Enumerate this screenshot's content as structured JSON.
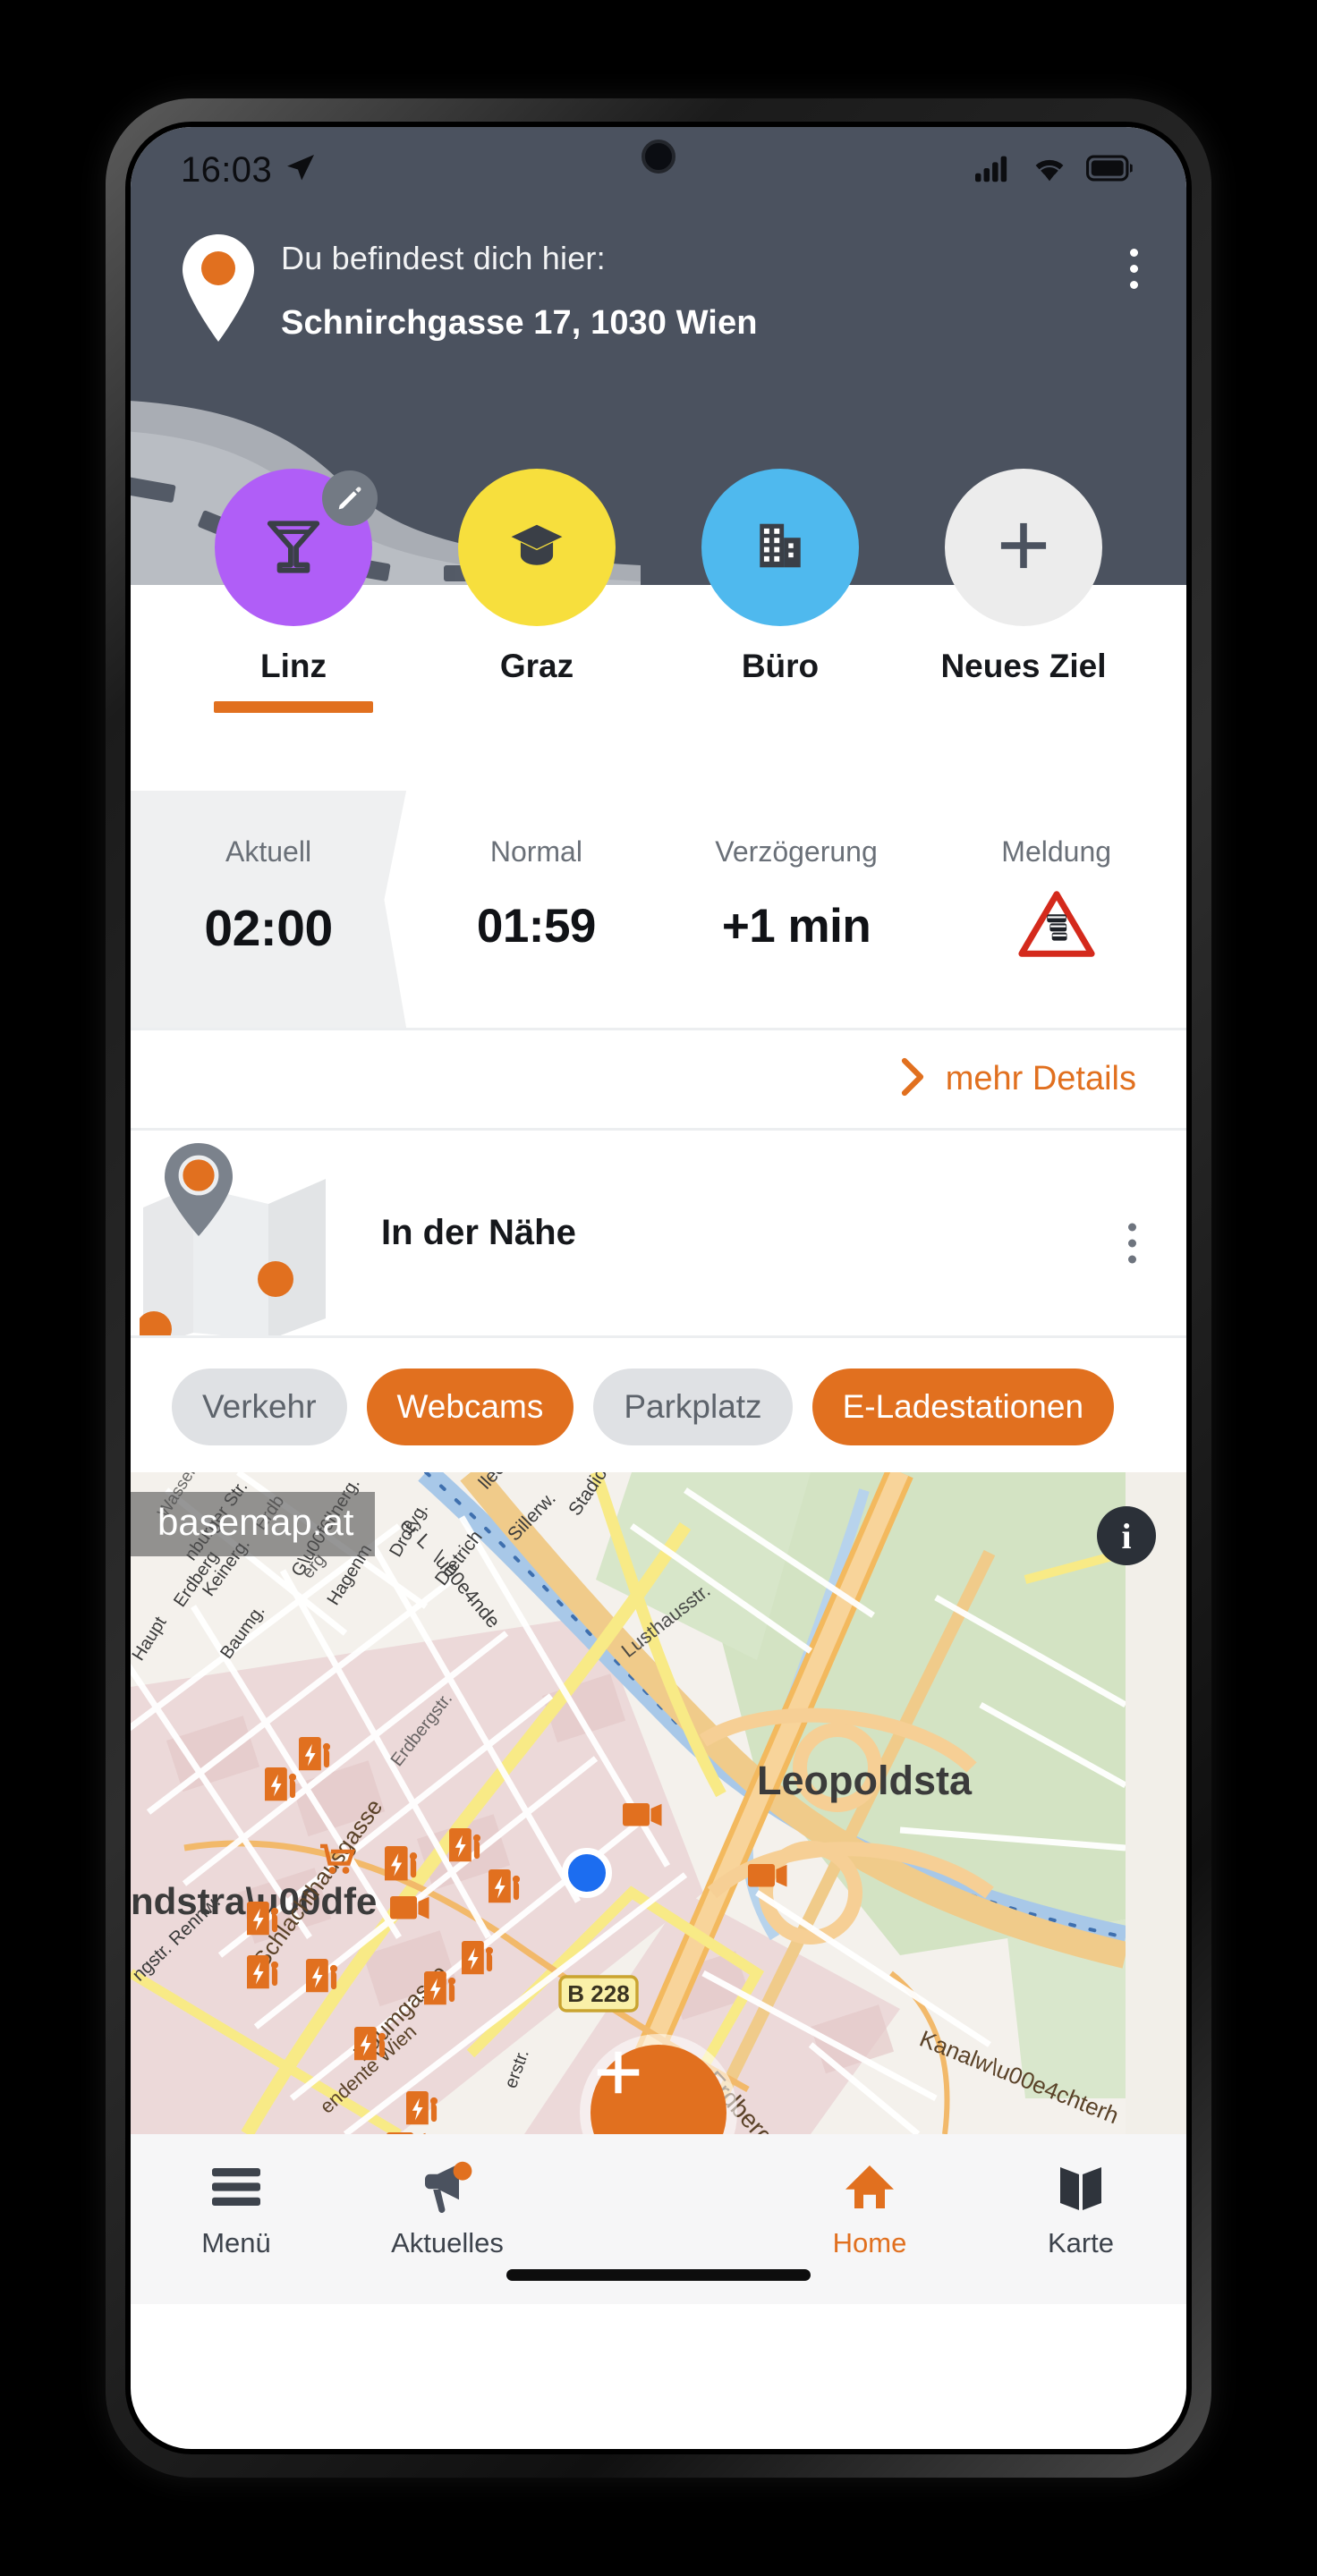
{
  "status_bar": {
    "time": "16:03",
    "location_arrow_icon": "navigation-arrow-icon",
    "signal_icon": "cellular-signal-icon",
    "wifi_icon": "wifi-icon",
    "battery_icon": "battery-full-icon"
  },
  "header": {
    "background_color": "#4b525f",
    "pin_icon": "map-pin-icon",
    "label": "Du befindest dich hier:",
    "address": "Schnirchgasse 17, 1030 Wien",
    "overflow_icon": "kebab-menu-icon"
  },
  "destinations": {
    "items": [
      {
        "label": "Linz",
        "icon": "cocktail-glass-icon",
        "color": "#b05ef7",
        "active": true,
        "editable": true,
        "edit_icon": "pencil-icon"
      },
      {
        "label": "Graz",
        "icon": "graduation-cap-icon",
        "color": "#f7df3d",
        "active": false,
        "editable": false
      },
      {
        "label": "Büro",
        "icon": "office-building-icon",
        "color": "#4fb9ee",
        "active": false,
        "editable": false
      },
      {
        "label": "Neues Ziel",
        "icon": "plus-icon",
        "color": "#ececec",
        "active": false,
        "editable": false
      }
    ]
  },
  "travel_times": {
    "cells": [
      {
        "label": "Aktuell",
        "value": "02:00",
        "highlighted": true
      },
      {
        "label": "Normal",
        "value": "01:59",
        "highlighted": false
      },
      {
        "label": "Verzögerung",
        "value": "+1 min",
        "highlighted": false
      },
      {
        "label": "Meldung",
        "value": "",
        "icon": "traffic-jam-warning-icon",
        "highlighted": false
      }
    ]
  },
  "details_link": {
    "chevron_icon": "chevron-right-icon",
    "label": "mehr Details"
  },
  "nearby": {
    "map_icon": "folded-map-icon",
    "title": "In der Nähe",
    "overflow_icon": "kebab-menu-icon"
  },
  "filter_chips": [
    {
      "label": "Verkehr",
      "selected": false
    },
    {
      "label": "Webcams",
      "selected": true
    },
    {
      "label": "Parkplatz",
      "selected": false
    },
    {
      "label": "E-Ladestationen",
      "selected": true
    }
  ],
  "map": {
    "attribution": "basemap.at",
    "info_button": "i",
    "info_icon": "info-icon",
    "user_location_icon": "current-location-dot",
    "add_button_icon": "plus-icon",
    "labels": [
      "Leopoldsta",
      "ndstraße",
      "Lusthausstr.",
      "Sillerw.",
      "Stadionallee",
      "llee",
      "er Lände",
      "Erdbe",
      "Wasser",
      "Dietrich",
      "Droryg.",
      "Göllnerg.",
      "Hagenm",
      "Erdbergstr.",
      "nburger Str.",
      "Haupt",
      "Keinerg.",
      "Baumg.",
      "ngstr. Rennw.",
      "Schlachthausgasse",
      "Baumgasse",
      "endente Wien",
      "B 228",
      "Erdbergstraße",
      "Kanalwächterh",
      "erstr."
    ],
    "marker_types": {
      "charging": "ev-charging-station-icon",
      "webcam": "webcam-icon",
      "shopping": "shopping-cart-icon"
    }
  },
  "bottom_nav": {
    "items": [
      {
        "label": "Menü",
        "icon": "hamburger-menu-icon",
        "active": false,
        "badge": false
      },
      {
        "label": "Aktuelles",
        "icon": "megaphone-icon",
        "active": false,
        "badge": true
      },
      {
        "label": "Home",
        "icon": "home-icon",
        "active": true,
        "badge": false
      },
      {
        "label": "Karte",
        "icon": "map-icon",
        "active": false,
        "badge": false
      }
    ]
  },
  "colors": {
    "accent_orange": "#e1701f",
    "header_dark": "#4b525f",
    "chip_off": "#dfe1e4",
    "text_dark": "#15171b"
  }
}
